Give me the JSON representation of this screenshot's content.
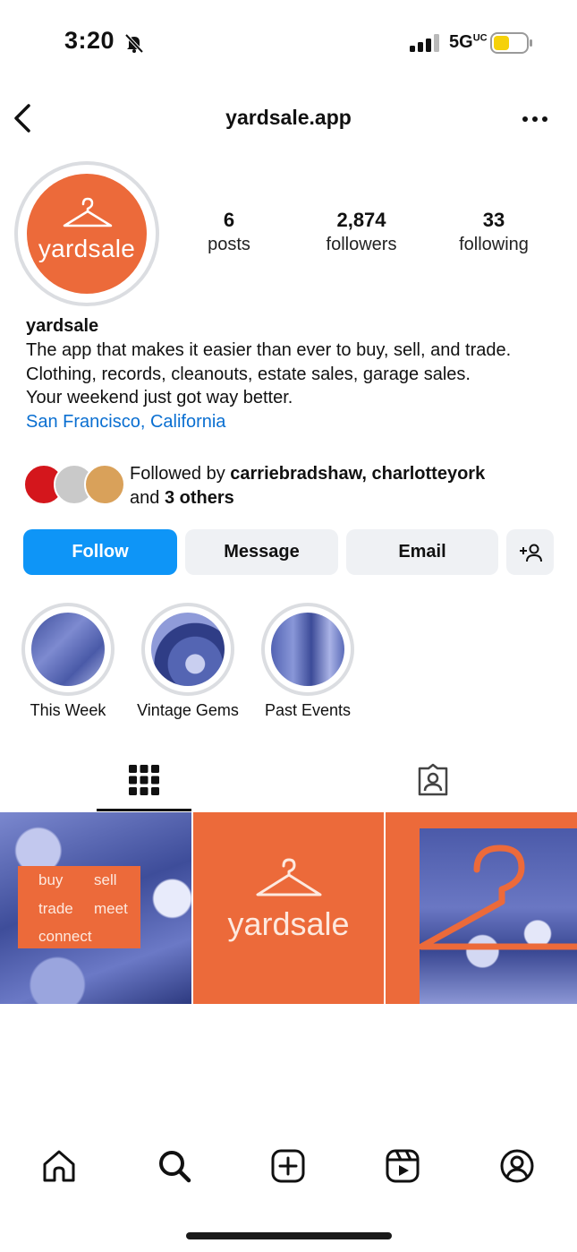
{
  "status_bar": {
    "time": "3:20",
    "network": "5G",
    "network_superscript": "UC",
    "icons": [
      "bell-slash-icon",
      "signal-icon",
      "battery-icon"
    ],
    "battery_color": "#f5d10a"
  },
  "header": {
    "title": "yardsale.app",
    "icons": [
      "chevron-left-icon",
      "more-horizontal-icon"
    ]
  },
  "profile": {
    "avatar_wordmark": "yardsale",
    "brand_color": "#ec6a3a",
    "stats": [
      {
        "value": "6",
        "label": "posts"
      },
      {
        "value": "2,874",
        "label": "followers"
      },
      {
        "value": "33",
        "label": "following"
      }
    ],
    "name": "yardsale",
    "bio_lines": [
      "The app that makes it easier than ever to buy, sell, and trade.",
      "Clothing, records, cleanouts, estate sales, garage sales.",
      "Your weekend just got way better."
    ],
    "location": "San Francisco, California",
    "followed_by": {
      "prefix": "Followed by",
      "names": "carriebradshaw, charlotteyork",
      "and": "and",
      "others": "3 others"
    }
  },
  "actions": {
    "follow": "Follow",
    "message": "Message",
    "email": "Email",
    "add_icon": "person-add-icon",
    "accent_color": "#0e95f7"
  },
  "highlights": [
    {
      "label": "This Week"
    },
    {
      "label": "Vintage Gems"
    },
    {
      "label": "Past Events"
    }
  ],
  "tabs": [
    "grid-icon",
    "tagged-icon"
  ],
  "posts": {
    "post1_words": [
      "buy",
      "sell",
      "trade",
      "meet",
      "connect"
    ],
    "post2_wordmark": "yardsale"
  },
  "bottom_nav": [
    "home-icon",
    "search-icon",
    "create-icon",
    "reels-icon",
    "profile-icon"
  ]
}
